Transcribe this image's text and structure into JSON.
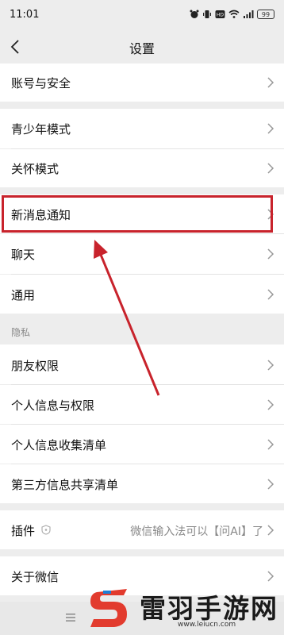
{
  "status": {
    "time": "11:01",
    "battery": "99"
  },
  "nav": {
    "title": "设置"
  },
  "rows": {
    "account": "账号与安全",
    "teen": "青少年模式",
    "care": "关怀模式",
    "notify": "新消息通知",
    "chat": "聊天",
    "general": "通用",
    "privacy_header": "隐私",
    "friends": "朋友权限",
    "personal": "个人信息与权限",
    "collect": "个人信息收集清单",
    "share": "第三方信息共享清单",
    "plugins": "插件",
    "plugins_value": "微信输入法可以【问AI】了",
    "about": "关于微信"
  },
  "watermark": {
    "text": "雷羽手游网",
    "url": "www.leiucn.com"
  },
  "colors": {
    "highlight": "#c8232c",
    "background": "#ededed"
  }
}
